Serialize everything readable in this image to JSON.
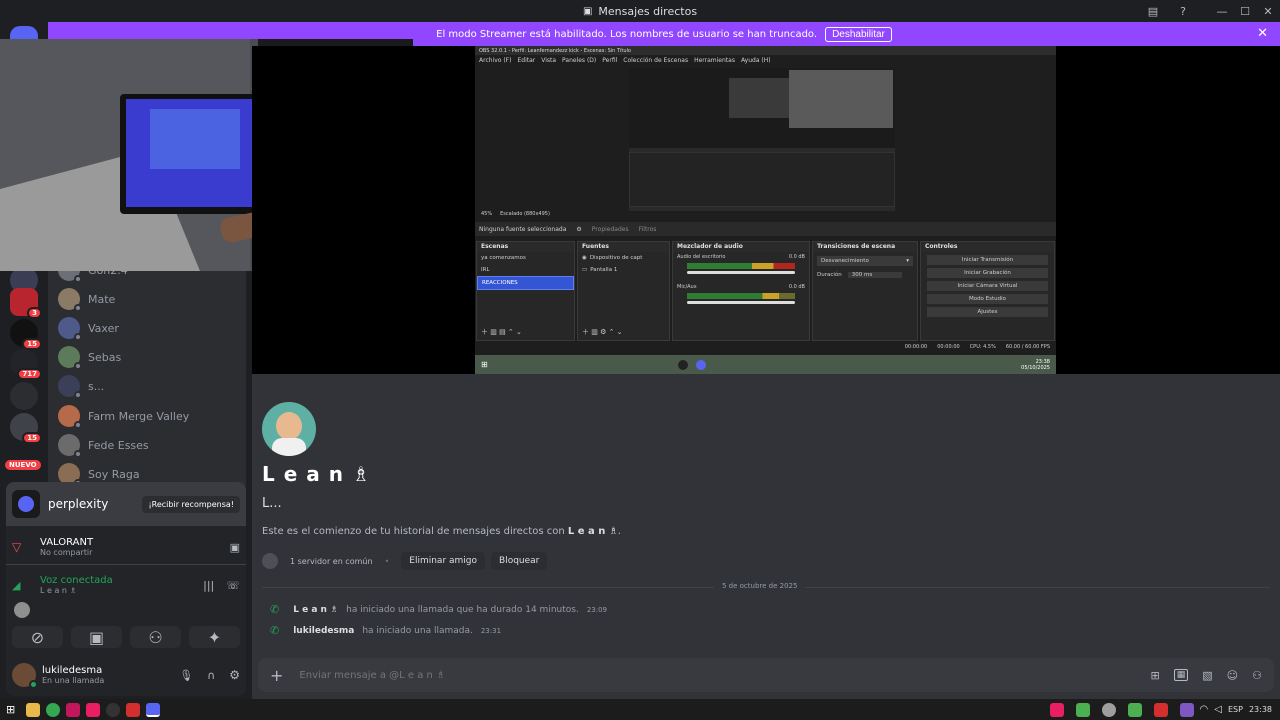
{
  "window": {
    "title": "Mensajes directos",
    "controls": [
      "—",
      "☐",
      "✕"
    ]
  },
  "banner": {
    "text": "El modo Streamer está habilitado. Los nombres de usuario se han truncado.",
    "button": "Deshabilitar",
    "close": "✕"
  },
  "servers": {
    "badges": [
      "3",
      "15",
      "717",
      "15"
    ],
    "new_label": "NUEVO"
  },
  "dm_list": [
    {
      "name": "Gon2.4",
      "color": "#6d6f78"
    },
    {
      "name": "Mate",
      "color": "#8a7a66"
    },
    {
      "name": "Vaxer",
      "color": "#4e5a8a"
    },
    {
      "name": "Sebas",
      "color": "#5d7a5a"
    },
    {
      "name": "s...",
      "color": "#3c3f58"
    },
    {
      "name": "Farm Merge Valley",
      "color": "#b76a4a"
    },
    {
      "name": "Fede Esses",
      "color": "#6b6b6b"
    },
    {
      "name": "Soy Raga",
      "color": "#8a6d52"
    }
  ],
  "promo": {
    "brand": "perplexity",
    "button": "¡Recibir recompensa!"
  },
  "activity": {
    "game": "VALORANT",
    "sub": "No compartir"
  },
  "voice": {
    "status": "Voz conectada",
    "channel": "L e a n ♗"
  },
  "user": {
    "name": "lukiledesma",
    "status": "En una llamada"
  },
  "obs": {
    "title": "OBS 32.0.1 - Perfil: Leanfernandezz kick - Escenas: Sin Título",
    "menu": [
      "Archivo (F)",
      "Editar",
      "Vista",
      "Paneles (D)",
      "Perfil",
      "Colección de Escenas",
      "Herramientas",
      "Ayuda (H)"
    ],
    "zoom_text": "45%",
    "scale_text": "Escalado (880x495)",
    "source_bar": "Ninguna fuente seleccionada",
    "props": "Propiedades",
    "filters": "Filtros",
    "docks": {
      "scenes": "Escenas",
      "sources": "Fuentes",
      "mixer": "Mezclador de audio",
      "transitions": "Transiciones de escena",
      "controls": "Controles"
    },
    "scenes": [
      "ya comenzamos",
      "IRL",
      "REACCIONES"
    ],
    "sources": [
      "Dispositivo de capt",
      "Pantalla 1"
    ],
    "mixer_channels": [
      {
        "name": "Audio del escritorio",
        "db": "0.0 dB"
      },
      {
        "name": "Mic/Aux",
        "db": "0.0 dB"
      }
    ],
    "transition": "Desvanecimiento",
    "duration_label": "Duración",
    "duration_value": "300 ms",
    "control_buttons": [
      "Iniciar Transmisión",
      "Iniciar Grabación",
      "Iniciar Cámara Virtual",
      "Modo Estudio",
      "Ajustes"
    ],
    "statusbar": {
      "t1": "00:00:00",
      "t2": "00:00:00",
      "cpu": "CPU: 4.5%",
      "fps": "60.00 / 60.00 FPS"
    },
    "taskbar_time": "23:38",
    "taskbar_date": "05/10/2025"
  },
  "chat": {
    "display_name": "L e a n ♗",
    "username": "L...",
    "intro_prefix": "Este es el comienzo de tu historial de mensajes directos con",
    "intro_name": "L e a n ♗",
    "mutual": "1 servidor en común",
    "remove_friend": "Eliminar amigo",
    "block": "Bloquear",
    "date_divider": "5 de octubre de 2025",
    "calls": [
      {
        "who": "L e a n ♗",
        "text": "ha iniciado una llamada que ha durado 14 minutos.",
        "time": "23:09"
      },
      {
        "who": "lukiledesma",
        "text": "ha iniciado una llamada.",
        "time": "23:31"
      }
    ],
    "composer_placeholder": "Enviar mensaje a @L e a n ♗"
  },
  "taskbar": {
    "lang": "ESP",
    "time": "23:38"
  }
}
